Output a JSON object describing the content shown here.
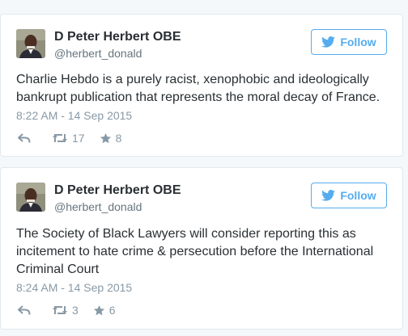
{
  "tweets": [
    {
      "author": {
        "name": "D Peter Herbert OBE",
        "handle": "@herbert_donald",
        "avatar_icon": "profile-photo"
      },
      "follow_label": "Follow",
      "text": "Charlie Hebdo is a purely racist, xenophobic and ideologically bankrupt publication that represents the moral decay of France.",
      "timestamp": "8:22 AM - 14 Sep 2015",
      "retweets": "17",
      "likes": "8"
    },
    {
      "author": {
        "name": "D Peter Herbert OBE",
        "handle": "@herbert_donald",
        "avatar_icon": "profile-photo"
      },
      "follow_label": "Follow",
      "text": "The Society of Black Lawyers will consider reporting this as incitement to hate crime & persecution before the International Criminal Court",
      "timestamp": "8:24 AM - 14 Sep 2015",
      "retweets": "3",
      "likes": "6"
    }
  ],
  "icons": {
    "follow": "twitter-bird-icon",
    "reply": "reply-icon",
    "retweet": "retweet-icon",
    "like": "star-icon"
  },
  "colors": {
    "accent": "#55acee",
    "text": "#292f33",
    "muted": "#8899a6",
    "handle": "#66757f",
    "border": "#e1e8ed",
    "background": "#f5f8fa"
  }
}
